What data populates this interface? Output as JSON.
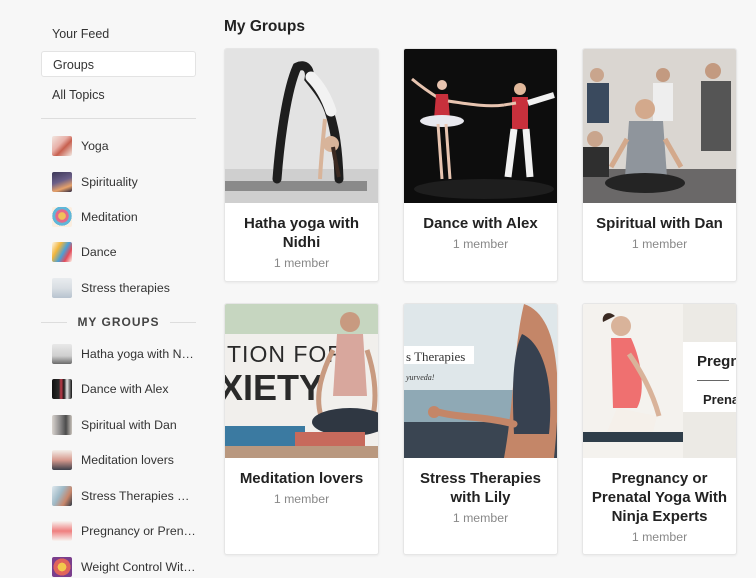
{
  "nav": {
    "feed": "Your Feed",
    "groups": "Groups",
    "topics": "All Topics"
  },
  "topics": [
    {
      "label": "Yoga",
      "icon": "yoga-thumb-icon"
    },
    {
      "label": "Spirituality",
      "icon": "spirituality-thumb-icon"
    },
    {
      "label": "Meditation",
      "icon": "meditation-thumb-icon"
    },
    {
      "label": "Dance",
      "icon": "dance-thumb-icon"
    },
    {
      "label": "Stress therapies",
      "icon": "stress-thumb-icon"
    }
  ],
  "my_groups_heading": "MY GROUPS",
  "my_groups": [
    {
      "label": "Hatha yoga with Nidhi"
    },
    {
      "label": "Dance with Alex"
    },
    {
      "label": "Spiritual with Dan"
    },
    {
      "label": "Meditation lovers"
    },
    {
      "label": "Stress Therapies with Lily"
    },
    {
      "label": "Pregnancy or Prenatal Yoga With Ninja Experts"
    },
    {
      "label": "Weight Control With Yoga"
    }
  ],
  "page_title": "My Groups",
  "cards": [
    {
      "name": "Hatha yoga with Nidhi",
      "members": "1 member"
    },
    {
      "name": "Dance with Alex",
      "members": "1 member"
    },
    {
      "name": "Spiritual with Dan",
      "members": "1 member"
    },
    {
      "name": "Meditation lovers",
      "members": "1 member",
      "img_text": "TION FOR\nXIETY"
    },
    {
      "name": "Stress Therapies with Lily",
      "members": "1 member",
      "img_text": "s Therapies",
      "img_sub": "yurveda!"
    },
    {
      "name": "Pregnancy or Prenatal Yoga With Ninja Experts",
      "members": "1 member",
      "img_text": "Pregna",
      "img_sub": "Prena"
    }
  ]
}
